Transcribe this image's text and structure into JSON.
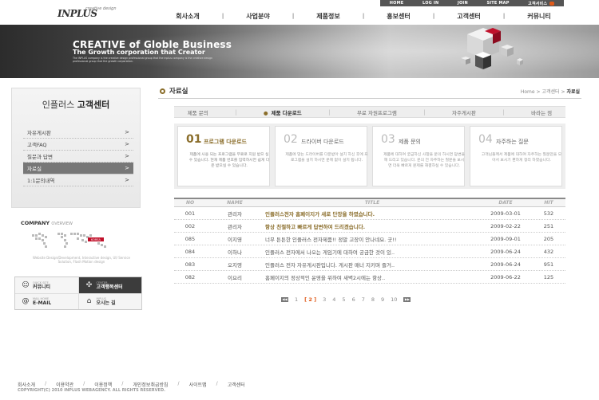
{
  "utility": {
    "home": "HOME",
    "login": "LOG IN",
    "join": "JOIN",
    "sitemap": "SITE MAP",
    "customer_service": "고객서비스"
  },
  "logo": {
    "brand": "INPLUS",
    "tagline": "creative design"
  },
  "gnb": [
    "회사소개",
    "사업분야",
    "제품정보",
    "홍보센터",
    "고객센터",
    "커뮤니티"
  ],
  "banner": {
    "headline": "CREATIVE of Globle Business",
    "subline": "The Growth corporation that Creator",
    "fine": "The INPLUS company is the creative design professional group that the inplus company is the creative design professional group that the growth corporation."
  },
  "lnb": {
    "title_a": "인플러스",
    "title_b": "고객센터",
    "items": [
      {
        "label": "자유게시판",
        "arrow": ">"
      },
      {
        "label": "고객FAQ",
        "arrow": ">"
      },
      {
        "label": "질문과 답변",
        "arrow": ">"
      },
      {
        "label": "자료실",
        "arrow": ">"
      },
      {
        "label": "1:1문의내역",
        "arrow": ">"
      }
    ]
  },
  "company": {
    "title": "COMPANY",
    "title_sub": "OVERVIEW",
    "fine": "Website Design/Development, Interactive design, UI/ Service Solution, Flash Motion design"
  },
  "quick": [
    {
      "en": "QUICK SITE",
      "ko": "커뮤니티",
      "icon": "community-icon"
    },
    {
      "en": "CENTER",
      "ko": "고객행복센터",
      "icon": "center-icon"
    },
    {
      "en": "MAIL HOME",
      "ko": "E-MAIL",
      "icon": "email-icon"
    },
    {
      "en": "INPLUS",
      "ko": "오시는 길",
      "icon": "location-icon"
    }
  ],
  "page": {
    "title": "자료실"
  },
  "breadcrumb": {
    "home": "Home",
    "sep": ">",
    "mid": "고객센터",
    "current": "자료실"
  },
  "subtabs": [
    "제품 문의",
    "제품 다운로드",
    "무료 자원프로그램",
    "자주게시판",
    "바라는 점"
  ],
  "cards": [
    {
      "num": "01",
      "title": "프로그램 다운로드",
      "desc": "제품에 사용 되는 프로그램을 무료로 지원 받으 실 수 있습니다. 현재 제품 번호를 입력하시면 쉽게 다운 받으실 수 있습니다."
    },
    {
      "num": "02",
      "title": "드라이버 다운로드",
      "desc": "제품에 맞는 드라이버를 다운받아 설치 하신 후에 프로그램을 설치 하시면 문제 없이 설치 됩니다."
    },
    {
      "num": "03",
      "title": "제품 문의",
      "desc": "제품에 대하여 궁금하신 사항을 문의 하시면 답변을 해 드리고 있습니다. 문의 전 자주하는 질문을 보시면 더욱 빠르게 문제를 해결하실 수 있습니다."
    },
    {
      "num": "04",
      "title": "자주하는 질문",
      "desc": "고객님들께서 제품에 대하여 자주하는 질문만을 모아서 보시기 편하게 정리 하였습니다."
    }
  ],
  "board": {
    "headers": {
      "no": "NO",
      "name": "NAME",
      "title": "TITLE",
      "date": "DATE",
      "hit": "HIT"
    },
    "rows": [
      {
        "no": "001",
        "name": "관리자",
        "title": "인플러스전자 홈페이지가 새로 단장을 하였습니다.",
        "date": "2009-03-01",
        "hit": "532",
        "hl": true
      },
      {
        "no": "002",
        "name": "관리자",
        "title": "항상 친절하고 빠르게 답변하여 드리겠습니다.",
        "date": "2009-02-22",
        "hit": "251",
        "hl": true
      },
      {
        "no": "085",
        "name": "이지영",
        "title": "너무 튼튼한 인플러스 전자제품!! 정말 고장이 안나네요. 굿!!",
        "date": "2009-09-01",
        "hit": "205",
        "hl": false
      },
      {
        "no": "084",
        "name": "이하나",
        "title": "인플러스 전자에서 나오는 게임기에 대하여 궁금한 것이 있..",
        "date": "2009-06-24",
        "hit": "432",
        "hl": false
      },
      {
        "no": "083",
        "name": "오지영",
        "title": "인플러스 전자 자유게시판입니다. 게시판 매너 지키며 즐거..",
        "date": "2009-06-24",
        "hit": "951",
        "hl": false
      },
      {
        "no": "082",
        "name": "이요리",
        "title": "홈페이지의 정상적인 운영을 위하여 새벽2시에는 항상..",
        "date": "2009-06-22",
        "hit": "125",
        "hl": false
      }
    ]
  },
  "pager": {
    "prev": "◀◀",
    "pages": [
      "1",
      "[ 2 ]",
      "3",
      "4",
      "5",
      "6",
      "7",
      "8",
      "9",
      "10"
    ],
    "next": "▶▶"
  },
  "footer": {
    "links": [
      "회사소개",
      "이용약관",
      "이용정책",
      "개인정보취급방침",
      "사이트맵",
      "고객센터"
    ],
    "copyright": "COPYRIGHT(C) 2010 INPLUS WEBAGENCY. ALL RIGHTS RESERVED."
  },
  "colors": {
    "accent": "#8a6d2a",
    "orange": "#e05a1a",
    "dark": "#555555"
  }
}
